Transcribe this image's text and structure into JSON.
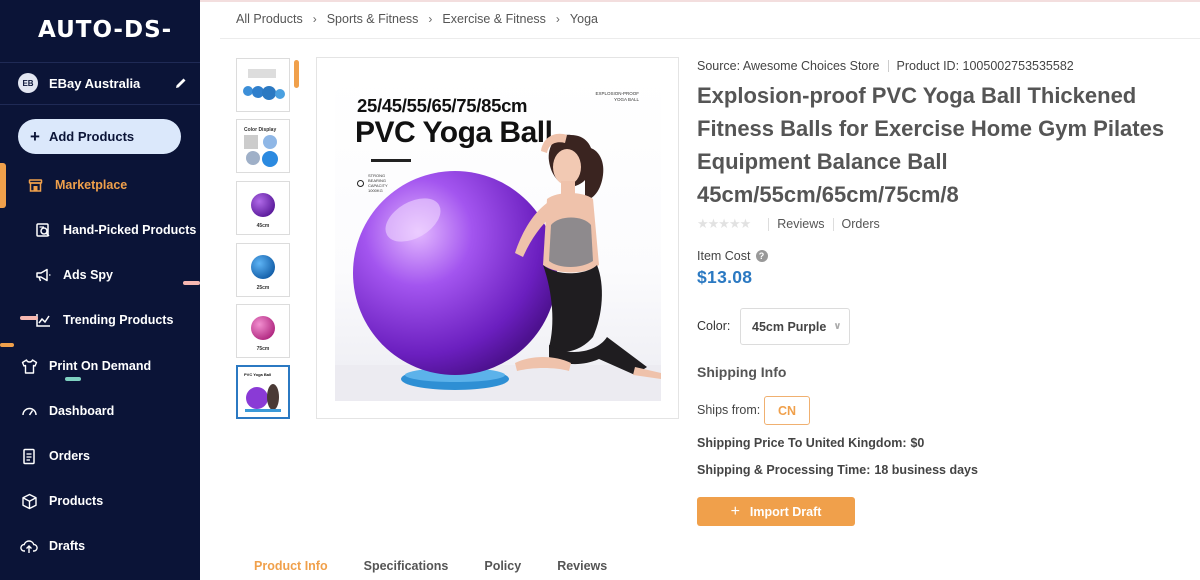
{
  "app": {
    "logo_text": "AUTO-DS-"
  },
  "colors": {
    "sidebar_bg": "#0b1437",
    "accent_orange": "#f0a04b",
    "link_blue": "#2b79c2",
    "add_button_bg": "#dbe8fb"
  },
  "sidebar": {
    "account": {
      "initials": "EB",
      "name": "EBay Australia",
      "edit_icon": "pencil-icon"
    },
    "add_products_label": "Add Products",
    "items": [
      {
        "label": "Marketplace",
        "icon": "store-icon",
        "active": true
      },
      {
        "label": "Hand-Picked Products",
        "icon": "hand-picked-icon"
      },
      {
        "label": "Ads Spy",
        "icon": "megaphone-icon"
      },
      {
        "label": "Trending Products",
        "icon": "trending-chart-icon"
      },
      {
        "label": "Print On Demand",
        "icon": "shirt-icon"
      },
      {
        "label": "Dashboard",
        "icon": "gauge-icon"
      },
      {
        "label": "Orders",
        "icon": "orders-list-icon"
      },
      {
        "label": "Products",
        "icon": "box-icon"
      },
      {
        "label": "Drafts",
        "icon": "cloud-upload-icon"
      }
    ]
  },
  "breadcrumb": [
    "All Products",
    "Sports & Fitness",
    "Exercise & Fitness",
    "Yoga"
  ],
  "gallery": {
    "thumbnails": [
      {
        "label": "",
        "kind": "multi-blue"
      },
      {
        "label": "",
        "kind": "color-display"
      },
      {
        "label": "45cm",
        "kind": "purple"
      },
      {
        "label": "25cm",
        "kind": "blue"
      },
      {
        "label": "75cm",
        "kind": "pink"
      },
      {
        "label": "",
        "kind": "main",
        "selected": true
      }
    ],
    "main_image": {
      "sizes_text": "25/45/55/65/75/85cm",
      "title_text": "PVC Yoga Ball",
      "tag_text": "EXPLOSION-PROOF YOGA BALL",
      "badge_text": "STRONG BEARING CAPACITY 1000KG"
    }
  },
  "product": {
    "source": "Source: Awesome Choices Store",
    "product_id": "Product ID: 1005002753535582",
    "title": "Explosion-proof PVC Yoga Ball Thickened Fitness Balls for Exercise Home Gym Pilates Equipment Balance Ball 45cm/55cm/65cm/75cm/8",
    "rating": {
      "stars": 0,
      "reviews_label": "Reviews",
      "orders_label": "Orders"
    },
    "item_cost_label": "Item Cost",
    "item_cost": "$13.08",
    "color_label": "Color:",
    "color_value": "45cm Purple",
    "shipping": {
      "heading": "Shipping Info",
      "ships_from_label": "Ships from:",
      "ships_from_value": "CN",
      "price_label": "Shipping Price To United Kingdom:",
      "price_value": "$0",
      "time_label": "Shipping & Processing Time:",
      "time_value": "18 business days"
    },
    "import_label": "Import Draft"
  },
  "tabs": [
    {
      "label": "Product Info",
      "active": true
    },
    {
      "label": "Specifications"
    },
    {
      "label": "Policy"
    },
    {
      "label": "Reviews"
    }
  ]
}
